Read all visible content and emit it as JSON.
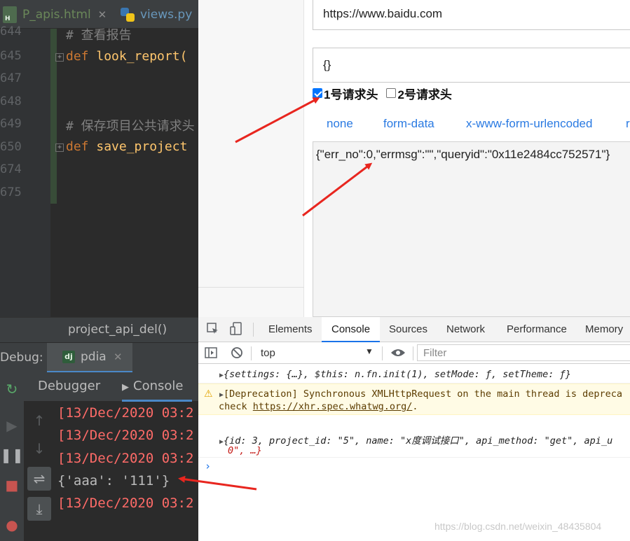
{
  "ide": {
    "tabs": [
      {
        "label": "P_apis.html",
        "close": "✕"
      },
      {
        "label": "views.py",
        "close": "✕"
      }
    ],
    "line_numbers": [
      "644",
      "645",
      "647",
      "648",
      "649",
      "650",
      "674",
      "675"
    ],
    "code": {
      "comment1": "# 查看报告",
      "def1_kw": "def",
      "def1_name": "look_report(",
      "comment2": "# 保存项目公共请求头",
      "def2_kw": "def",
      "def2_name": "save_project"
    },
    "expand_glyph": ">",
    "breadcrumb": "project_api_del()",
    "debug": {
      "label": "Debug:",
      "tab_icon_text": "dj",
      "tab_label": "pdia",
      "tab_close": "✕",
      "tabs": [
        "Debugger",
        "Console"
      ]
    },
    "output_lines": [
      "[13/Dec/2020 03:2",
      "[13/Dec/2020 03:2",
      "[13/Dec/2020 03:2",
      "{'aaa': '111'}",
      "[13/Dec/2020 03:2"
    ]
  },
  "browser": {
    "url_value": "https://www.baidu.com",
    "headers_json": "{}",
    "checkbox1": {
      "label": "1号请求头",
      "checked": true
    },
    "checkbox2": {
      "label": "2号请求头",
      "checked": false
    },
    "body_tabs": [
      "none",
      "form-data",
      "x-www-form-urlencoded",
      "r"
    ],
    "response": "{\"err_no\":0,\"errmsg\":\"\",\"queryid\":\"0x11e2484cc752571\"}"
  },
  "devtools": {
    "tabs": [
      "Elements",
      "Console",
      "Sources",
      "Network",
      "Performance",
      "Memory"
    ],
    "active_tab": "Console",
    "context": "top",
    "filter_placeholder": "Filter",
    "messages": {
      "m1": "{settings: {…}, $this: n.fn.init(1), setMode: ƒ, setTheme: ƒ}",
      "warn_line1": "[Deprecation] Synchronous XMLHttpRequest on the main thread is depreca",
      "warn_line2_prefix": "check ",
      "warn_link": "https://xhr.spec.whatwg.org/",
      "warn_line2_suffix": ".",
      "m3_line1": "{id: 3, project_id: \"5\", name: \"x度调试接口\", api_method: \"get\", api_u",
      "m3_line2": "0\", …}"
    },
    "prompt": "›"
  },
  "watermark": "https://blog.csdn.net/weixin_48435804",
  "colors": {
    "ide_bg": "#2b2b2b",
    "ide_panel": "#3c3f41",
    "keyword": "#cc7832",
    "function": "#ffc66d",
    "error_red": "#ff6b68",
    "link_blue": "#2a7ae2",
    "arrow_red": "#e8261f"
  }
}
